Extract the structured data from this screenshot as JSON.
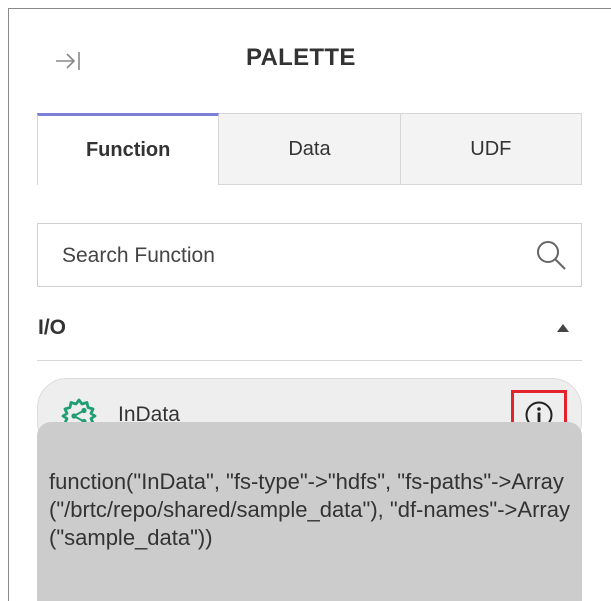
{
  "header": {
    "collapse_icon": "collapse-right-icon",
    "title": "PALETTE"
  },
  "tabs": [
    {
      "label": "Function",
      "active": true
    },
    {
      "label": "Data",
      "active": false
    },
    {
      "label": "UDF",
      "active": false
    }
  ],
  "search": {
    "placeholder": "Search Function",
    "value": "",
    "icon": "search-icon"
  },
  "section": {
    "label": "I/O",
    "toggle_icon": "collapse-up-icon",
    "items": [
      {
        "label": "InData",
        "icon": "gear-share-icon",
        "info_icon": "info-icon",
        "tooltip": "function(\"InData\", \"fs-type\"->\"hdfs\", \"fs-paths\"->Array(\"/brtc/repo/shared/sample_data\"), \"df-names\"->Array(\"sample_data\"))"
      }
    ]
  },
  "colors": {
    "active_tab_accent": "#7b82d6",
    "highlight": "#e2232b",
    "item_icon": "#1f9e74",
    "tooltip_bg": "#cccccc"
  }
}
